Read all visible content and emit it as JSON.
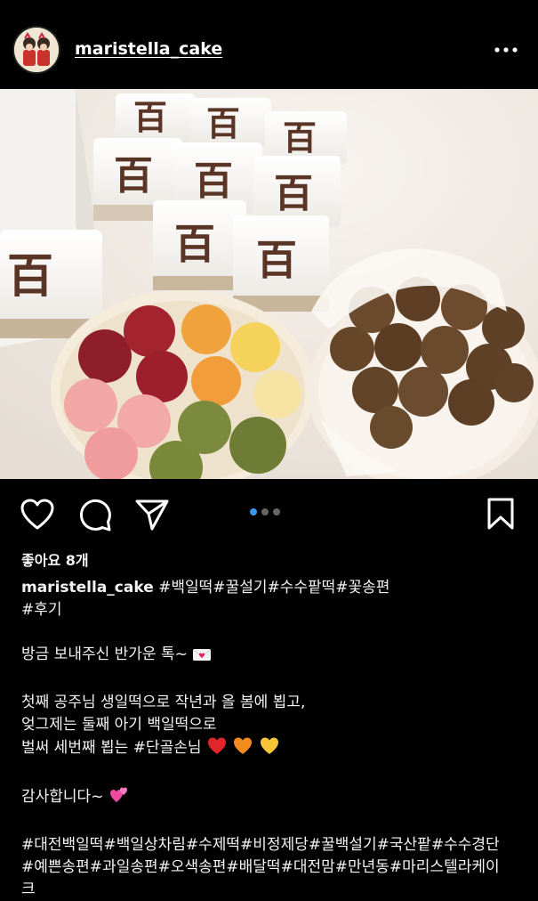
{
  "post": {
    "username": "maristella_cake",
    "likes_text": "좋아요 8개",
    "carousel": {
      "count": 3,
      "active_index": 0
    },
    "caption": {
      "first_line_tags": "#백일떡#꿀설기#수수팥떡#꽃송편",
      "second_line_tag": "#후기",
      "line_3": "방금 보내주신 반가운 톡~",
      "line_4": "첫째 공주님 생일떡으로 작년과 올 봄에 뵙고,",
      "line_5": "엊그제는 둘째 아기 백일떡으로",
      "line_6": "벌써 세번째 뵙는 #단골손님",
      "line_7": "감사합니다~",
      "hashtags_1": "#대전백일떡#백일상차림#수제떡#비정제당#꿀백설기#국산팥#수수경단",
      "hashtags_2": "#예쁜송편#과일송편#오색송편#배달떡#대전맘#만년동#마리스텔라케이",
      "hashtags_3": "크"
    },
    "photo_stamp_char": "百"
  },
  "icons": {
    "more": "more-horizontal-icon",
    "like": "heart-icon",
    "comment": "comment-bubble-icon",
    "share": "paper-plane-icon",
    "save": "bookmark-icon"
  },
  "colors": {
    "background": "#000000",
    "text": "#f5f5f5",
    "carousel_active": "#3897f0",
    "carousel_inactive": "#666666"
  }
}
